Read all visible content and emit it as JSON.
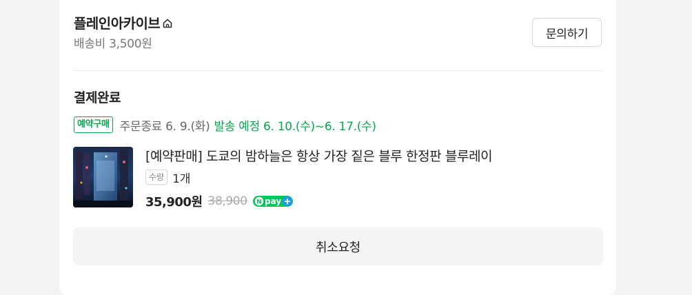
{
  "seller": {
    "name": "플레인아카이브",
    "shipping_fee": "배송비 3,500원",
    "inquiry_label": "문의하기",
    "icon": "home-icon"
  },
  "order": {
    "status": "결제완료",
    "badge": "예약구매",
    "order_close": "주문종료 6. 9.(화)",
    "ship_plan": "발송 예정 6. 10.(수)~6. 17.(수)",
    "accent_color": "#03a94d"
  },
  "product": {
    "title": "[예약판매] 도쿄의 밤하늘은 항상 가장 짙은 블루 한정판 블루레이",
    "qty_label": "수량",
    "qty_value": "1개",
    "price": "35,900원",
    "original_price": "38,900",
    "npay": {
      "n_letter": "N",
      "text": "pay",
      "plus": "+"
    }
  },
  "actions": {
    "cancel_label": "취소요청"
  }
}
